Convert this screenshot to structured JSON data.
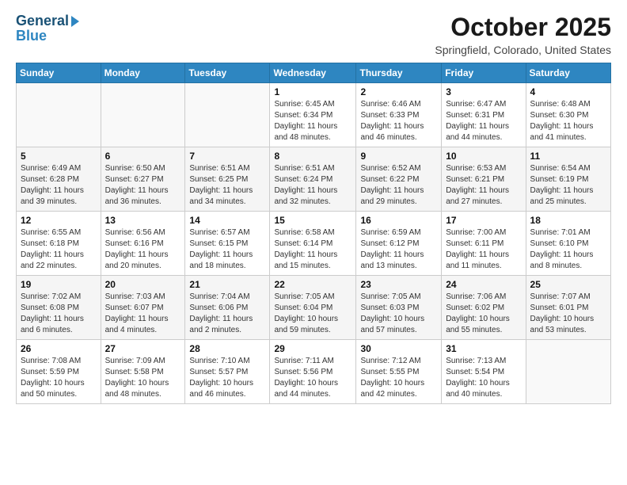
{
  "logo": {
    "line1": "General",
    "line2": "Blue"
  },
  "title": "October 2025",
  "location": "Springfield, Colorado, United States",
  "days_header": [
    "Sunday",
    "Monday",
    "Tuesday",
    "Wednesday",
    "Thursday",
    "Friday",
    "Saturday"
  ],
  "weeks": [
    [
      {
        "day": "",
        "info": ""
      },
      {
        "day": "",
        "info": ""
      },
      {
        "day": "",
        "info": ""
      },
      {
        "day": "1",
        "info": "Sunrise: 6:45 AM\nSunset: 6:34 PM\nDaylight: 11 hours\nand 48 minutes."
      },
      {
        "day": "2",
        "info": "Sunrise: 6:46 AM\nSunset: 6:33 PM\nDaylight: 11 hours\nand 46 minutes."
      },
      {
        "day": "3",
        "info": "Sunrise: 6:47 AM\nSunset: 6:31 PM\nDaylight: 11 hours\nand 44 minutes."
      },
      {
        "day": "4",
        "info": "Sunrise: 6:48 AM\nSunset: 6:30 PM\nDaylight: 11 hours\nand 41 minutes."
      }
    ],
    [
      {
        "day": "5",
        "info": "Sunrise: 6:49 AM\nSunset: 6:28 PM\nDaylight: 11 hours\nand 39 minutes."
      },
      {
        "day": "6",
        "info": "Sunrise: 6:50 AM\nSunset: 6:27 PM\nDaylight: 11 hours\nand 36 minutes."
      },
      {
        "day": "7",
        "info": "Sunrise: 6:51 AM\nSunset: 6:25 PM\nDaylight: 11 hours\nand 34 minutes."
      },
      {
        "day": "8",
        "info": "Sunrise: 6:51 AM\nSunset: 6:24 PM\nDaylight: 11 hours\nand 32 minutes."
      },
      {
        "day": "9",
        "info": "Sunrise: 6:52 AM\nSunset: 6:22 PM\nDaylight: 11 hours\nand 29 minutes."
      },
      {
        "day": "10",
        "info": "Sunrise: 6:53 AM\nSunset: 6:21 PM\nDaylight: 11 hours\nand 27 minutes."
      },
      {
        "day": "11",
        "info": "Sunrise: 6:54 AM\nSunset: 6:19 PM\nDaylight: 11 hours\nand 25 minutes."
      }
    ],
    [
      {
        "day": "12",
        "info": "Sunrise: 6:55 AM\nSunset: 6:18 PM\nDaylight: 11 hours\nand 22 minutes."
      },
      {
        "day": "13",
        "info": "Sunrise: 6:56 AM\nSunset: 6:16 PM\nDaylight: 11 hours\nand 20 minutes."
      },
      {
        "day": "14",
        "info": "Sunrise: 6:57 AM\nSunset: 6:15 PM\nDaylight: 11 hours\nand 18 minutes."
      },
      {
        "day": "15",
        "info": "Sunrise: 6:58 AM\nSunset: 6:14 PM\nDaylight: 11 hours\nand 15 minutes."
      },
      {
        "day": "16",
        "info": "Sunrise: 6:59 AM\nSunset: 6:12 PM\nDaylight: 11 hours\nand 13 minutes."
      },
      {
        "day": "17",
        "info": "Sunrise: 7:00 AM\nSunset: 6:11 PM\nDaylight: 11 hours\nand 11 minutes."
      },
      {
        "day": "18",
        "info": "Sunrise: 7:01 AM\nSunset: 6:10 PM\nDaylight: 11 hours\nand 8 minutes."
      }
    ],
    [
      {
        "day": "19",
        "info": "Sunrise: 7:02 AM\nSunset: 6:08 PM\nDaylight: 11 hours\nand 6 minutes."
      },
      {
        "day": "20",
        "info": "Sunrise: 7:03 AM\nSunset: 6:07 PM\nDaylight: 11 hours\nand 4 minutes."
      },
      {
        "day": "21",
        "info": "Sunrise: 7:04 AM\nSunset: 6:06 PM\nDaylight: 11 hours\nand 2 minutes."
      },
      {
        "day": "22",
        "info": "Sunrise: 7:05 AM\nSunset: 6:04 PM\nDaylight: 10 hours\nand 59 minutes."
      },
      {
        "day": "23",
        "info": "Sunrise: 7:05 AM\nSunset: 6:03 PM\nDaylight: 10 hours\nand 57 minutes."
      },
      {
        "day": "24",
        "info": "Sunrise: 7:06 AM\nSunset: 6:02 PM\nDaylight: 10 hours\nand 55 minutes."
      },
      {
        "day": "25",
        "info": "Sunrise: 7:07 AM\nSunset: 6:01 PM\nDaylight: 10 hours\nand 53 minutes."
      }
    ],
    [
      {
        "day": "26",
        "info": "Sunrise: 7:08 AM\nSunset: 5:59 PM\nDaylight: 10 hours\nand 50 minutes."
      },
      {
        "day": "27",
        "info": "Sunrise: 7:09 AM\nSunset: 5:58 PM\nDaylight: 10 hours\nand 48 minutes."
      },
      {
        "day": "28",
        "info": "Sunrise: 7:10 AM\nSunset: 5:57 PM\nDaylight: 10 hours\nand 46 minutes."
      },
      {
        "day": "29",
        "info": "Sunrise: 7:11 AM\nSunset: 5:56 PM\nDaylight: 10 hours\nand 44 minutes."
      },
      {
        "day": "30",
        "info": "Sunrise: 7:12 AM\nSunset: 5:55 PM\nDaylight: 10 hours\nand 42 minutes."
      },
      {
        "day": "31",
        "info": "Sunrise: 7:13 AM\nSunset: 5:54 PM\nDaylight: 10 hours\nand 40 minutes."
      },
      {
        "day": "",
        "info": ""
      }
    ]
  ]
}
